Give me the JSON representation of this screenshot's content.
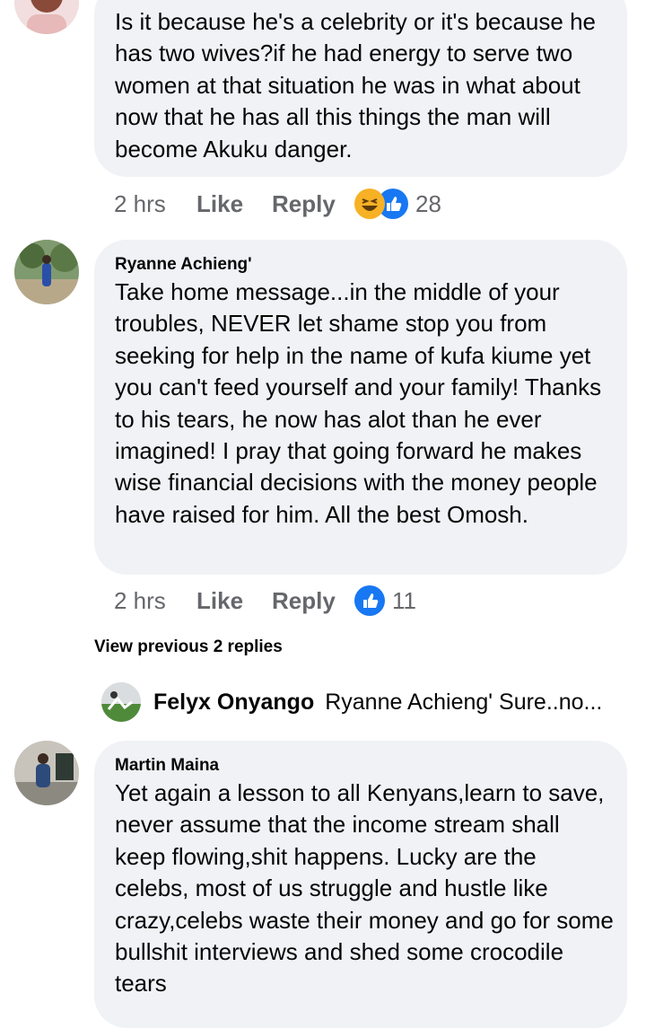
{
  "comments": [
    {
      "author": "",
      "text": "Is it because he's a celebrity or it's because he has two wives?if he had energy to serve two women at that situation he was in what about now that he has all this things the man will become Akuku danger.",
      "time": "2 hrs",
      "like_label": "Like",
      "reply_label": "Reply",
      "reaction_count": "28",
      "reactions": [
        "haha-icon",
        "like-icon"
      ]
    },
    {
      "author": "Ryanne Achieng'",
      "text": "Take home message...in the middle of your troubles, NEVER let shame stop you from seeking for help in the name of kufa kiume yet you can't feed yourself and your family! Thanks to his tears, he now has alot than he ever imagined! I pray that going forward he makes wise financial decisions with the money people have raised for him. All the best Omosh.",
      "time": "2 hrs",
      "like_label": "Like",
      "reply_label": "Reply",
      "reaction_count": "11",
      "reactions": [
        "like-icon"
      ]
    },
    {
      "author": "Martin Maina",
      "text": "Yet again a lesson to all Kenyans,learn to save, never assume that the income stream shall keep flowing,shit happens. Lucky are the celebs, most of us struggle and hustle like crazy,celebs waste their money and go for some bullshit interviews and shed some crocodile tears"
    }
  ],
  "view_previous": "View previous 2 replies",
  "reply_preview": {
    "author": "Felyx Onyango",
    "text": "Ryanne Achieng' Sure..no..."
  },
  "colors": {
    "bubble": "#f0f2f5",
    "meta": "#65676b",
    "like_blue": "#1877f2",
    "haha_yellow": "#f7b125"
  }
}
